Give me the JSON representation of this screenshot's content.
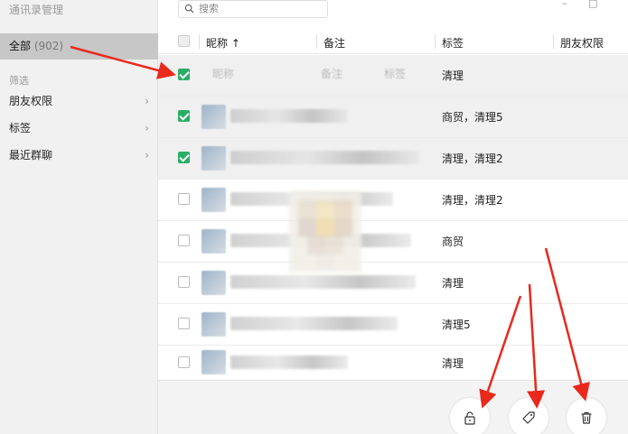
{
  "app": {
    "title": "通讯录管理"
  },
  "sidebar": {
    "all_label": "全部",
    "all_count": "(902)",
    "filter_label": "筛选",
    "items": [
      {
        "label": "朋友权限"
      },
      {
        "label": "标签"
      },
      {
        "label": "最近群聊"
      }
    ]
  },
  "search": {
    "placeholder": "搜索"
  },
  "window": {
    "minimize": "–",
    "maximize": "□"
  },
  "table": {
    "columns": [
      "昵称 ↑",
      "备注",
      "标签",
      "朋友权限"
    ],
    "rows": [
      {
        "checked": true,
        "tags": "清理"
      },
      {
        "checked": true,
        "tags": "商贸，清理5"
      },
      {
        "checked": true,
        "tags": "清理，清理2"
      },
      {
        "checked": false,
        "tags": "清理，清理2"
      },
      {
        "checked": false,
        "tags": "商贸"
      },
      {
        "checked": false,
        "tags": "清理"
      },
      {
        "checked": false,
        "tags": "清理5"
      },
      {
        "checked": false,
        "tags": "清理"
      }
    ],
    "ghost_header": [
      "昵称",
      "备注",
      "标签"
    ]
  },
  "footer": {
    "buttons": [
      {
        "icon": "lock-icon"
      },
      {
        "icon": "tag-icon"
      },
      {
        "icon": "trash-icon"
      }
    ]
  },
  "colors": {
    "accent": "#2aae67",
    "annotation": "#e8291c",
    "sidebar_selected": "#c7c7c7"
  }
}
